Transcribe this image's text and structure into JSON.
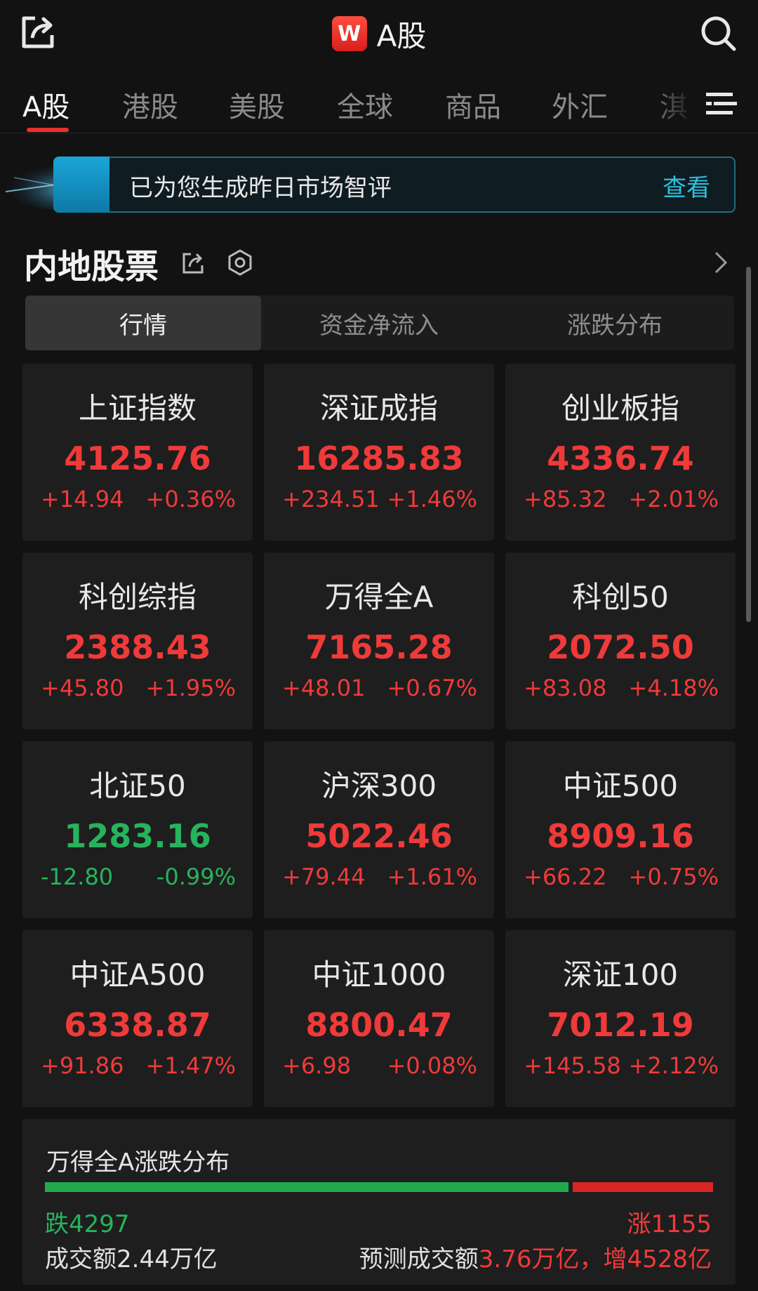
{
  "header": {
    "title": "A股",
    "logo_letter": "W"
  },
  "tabs": [
    "A股",
    "港股",
    "美股",
    "全球",
    "商品",
    "外汇",
    "淇"
  ],
  "banner": {
    "text": "已为您生成昨日市场智评",
    "link": "查看"
  },
  "section": {
    "title": "内地股票"
  },
  "segments": [
    "行情",
    "资金净流入",
    "涨跌分布"
  ],
  "indices": [
    {
      "name": "上证指数",
      "value": "4125.76",
      "change": "+14.94",
      "pct": "+0.36%",
      "trend": "up"
    },
    {
      "name": "深证成指",
      "value": "16285.83",
      "change": "+234.51",
      "pct": "+1.46%",
      "trend": "up"
    },
    {
      "name": "创业板指",
      "value": "4336.74",
      "change": "+85.32",
      "pct": "+2.01%",
      "trend": "up"
    },
    {
      "name": "科创综指",
      "value": "2388.43",
      "change": "+45.80",
      "pct": "+1.95%",
      "trend": "up"
    },
    {
      "name": "万得全A",
      "value": "7165.28",
      "change": "+48.01",
      "pct": "+0.67%",
      "trend": "up"
    },
    {
      "name": "科创50",
      "value": "2072.50",
      "change": "+83.08",
      "pct": "+4.18%",
      "trend": "up"
    },
    {
      "name": "北证50",
      "value": "1283.16",
      "change": "-12.80",
      "pct": "-0.99%",
      "trend": "down"
    },
    {
      "name": "沪深300",
      "value": "5022.46",
      "change": "+79.44",
      "pct": "+1.61%",
      "trend": "up"
    },
    {
      "name": "中证500",
      "value": "8909.16",
      "change": "+66.22",
      "pct": "+0.75%",
      "trend": "up"
    },
    {
      "name": "中证A500",
      "value": "6338.87",
      "change": "+91.86",
      "pct": "+1.47%",
      "trend": "up"
    },
    {
      "name": "中证1000",
      "value": "8800.47",
      "change": "+6.98",
      "pct": "+0.08%",
      "trend": "up"
    },
    {
      "name": "深证100",
      "value": "7012.19",
      "change": "+145.58",
      "pct": "+2.12%",
      "trend": "up"
    }
  ],
  "distribution": {
    "title": "万得全A涨跌分布",
    "fall_label": "跌4297",
    "rise_label": "涨1155",
    "fall_count": 4297,
    "rise_count": 1155,
    "turnover": "成交额2.44万亿",
    "forecast_prefix": "预测成交额",
    "forecast_value": "3.76万亿，增4528亿"
  },
  "colors": {
    "up": "#f03a3a",
    "down": "#27b35c",
    "accent": "#2ec0dd"
  }
}
